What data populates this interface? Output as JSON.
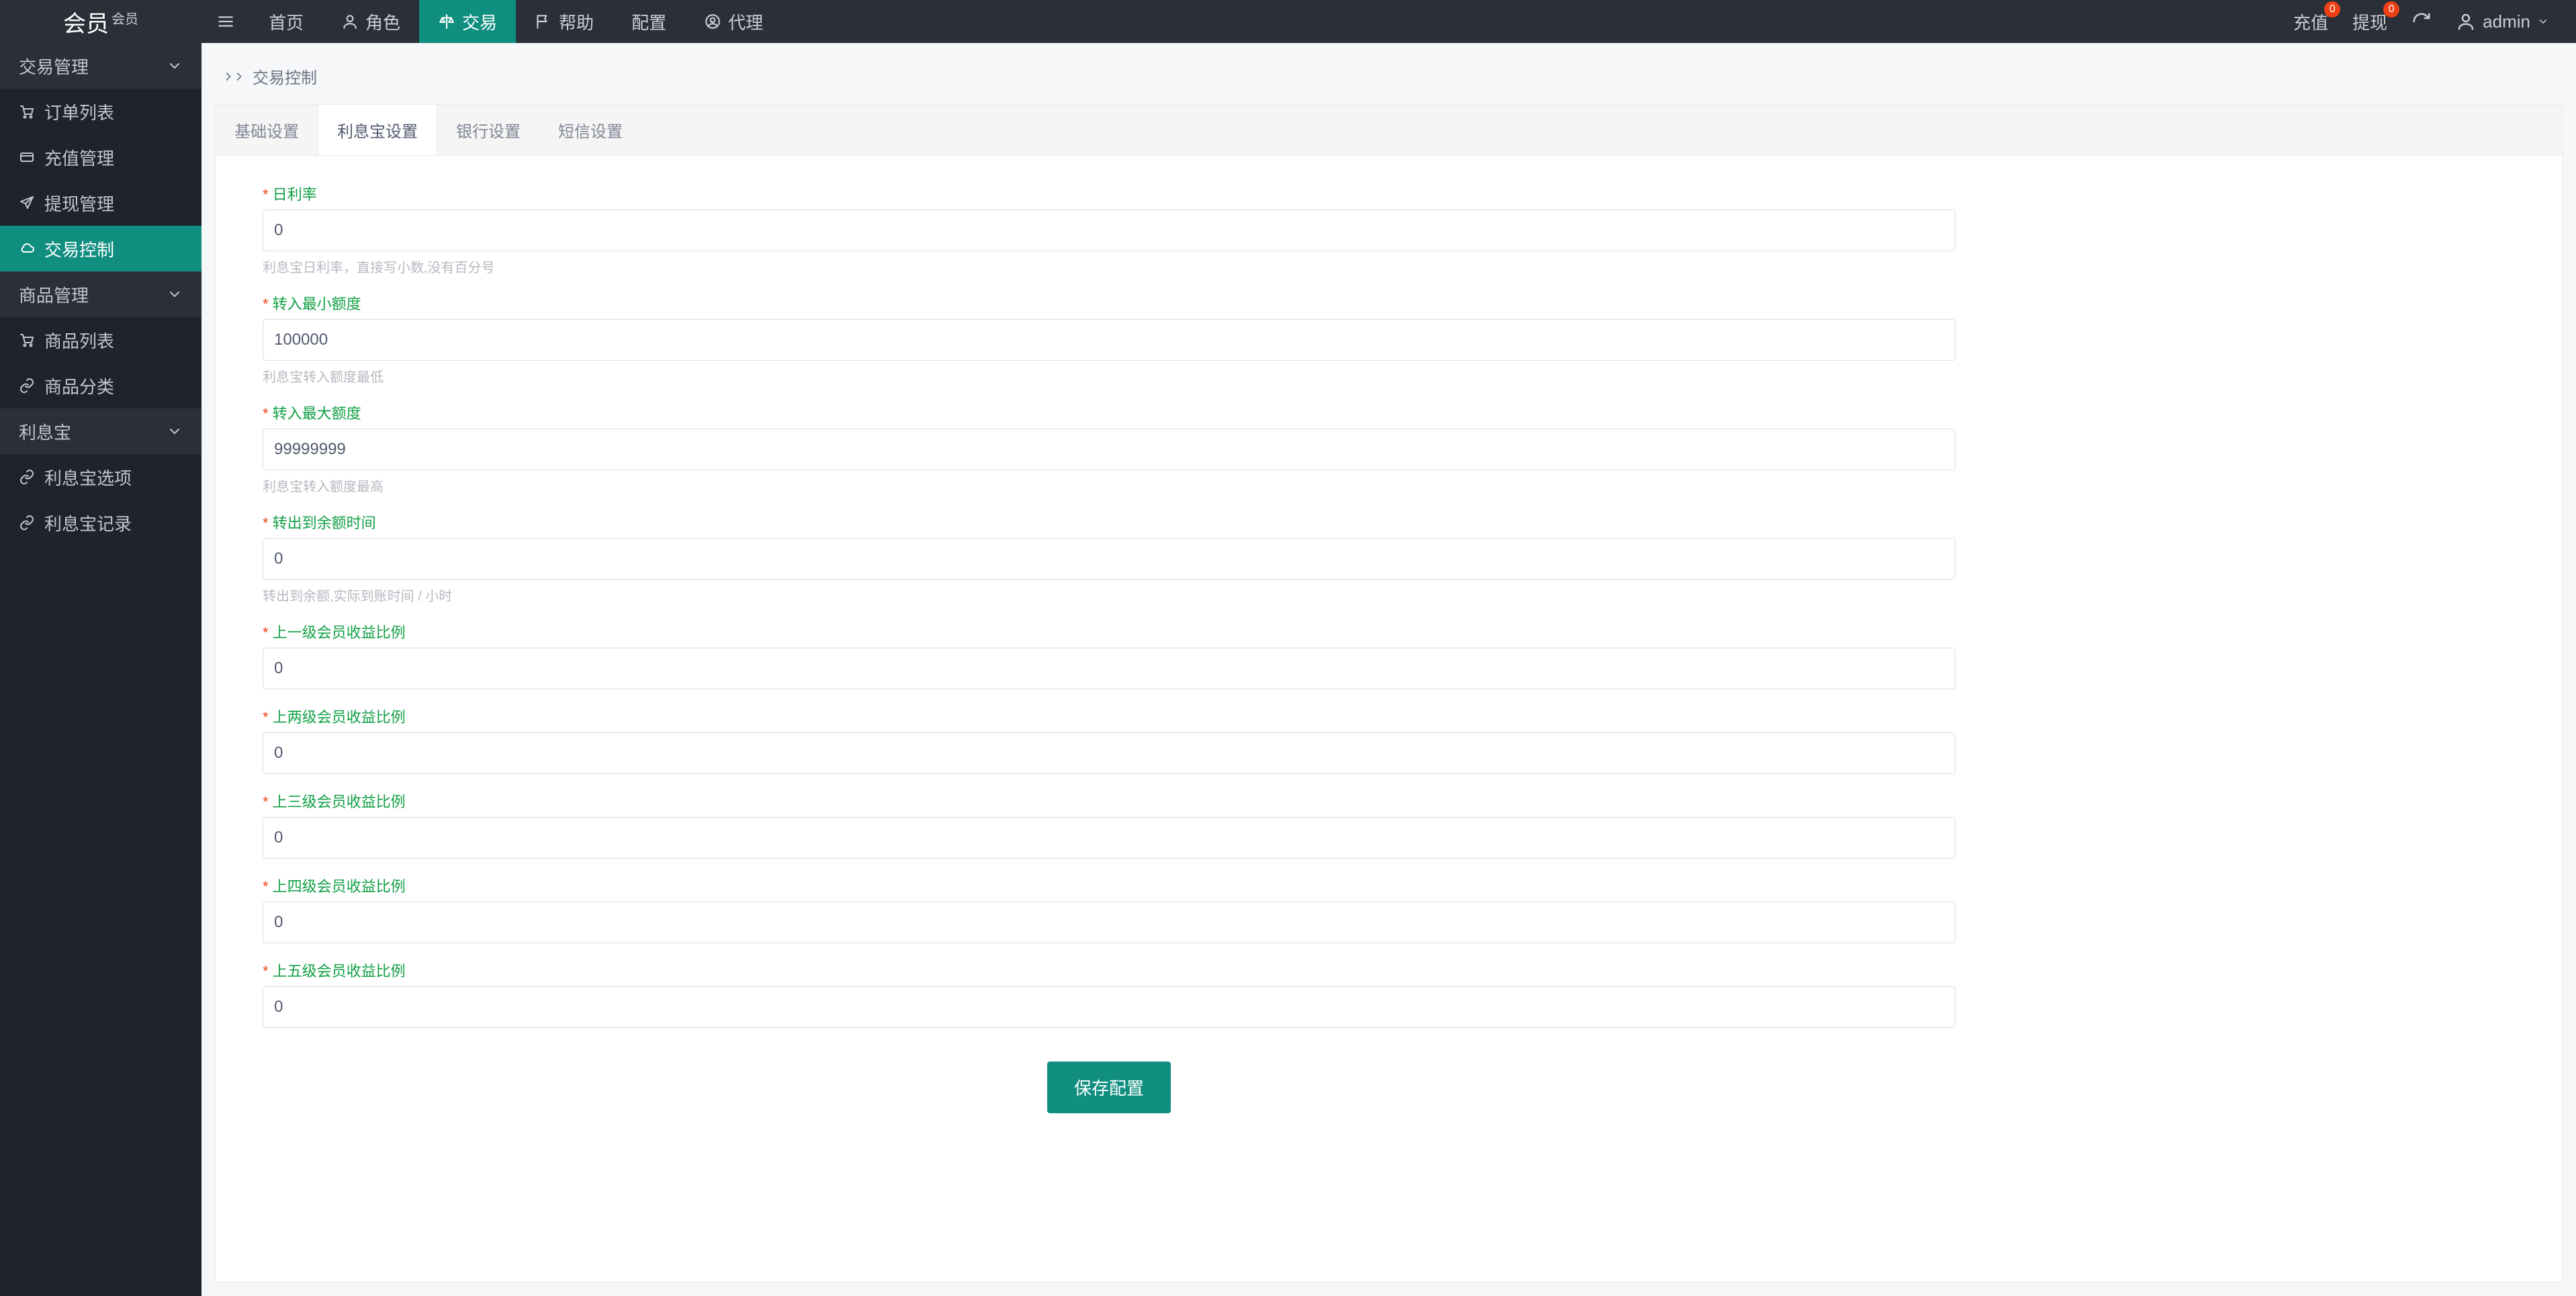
{
  "header": {
    "logo_main": "会员",
    "logo_sup": "会员",
    "nav": [
      {
        "label": "首页",
        "icon": null
      },
      {
        "label": "角色",
        "icon": "user"
      },
      {
        "label": "交易",
        "icon": "scale",
        "active": true
      },
      {
        "label": "帮助",
        "icon": "flag"
      },
      {
        "label": "配置",
        "icon": null
      },
      {
        "label": "代理",
        "icon": "user-circle"
      }
    ],
    "right": {
      "recharge": {
        "label": "充值",
        "badge": "0"
      },
      "withdraw": {
        "label": "提现",
        "badge": "0"
      },
      "user": "admin"
    }
  },
  "sidebar": {
    "groups": [
      {
        "title": "交易管理",
        "items": [
          {
            "label": "订单列表",
            "icon": "cart"
          },
          {
            "label": "充值管理",
            "icon": "card"
          },
          {
            "label": "提现管理",
            "icon": "plane"
          },
          {
            "label": "交易控制",
            "icon": "cloud",
            "active": true
          }
        ]
      },
      {
        "title": "商品管理",
        "items": [
          {
            "label": "商品列表",
            "icon": "cart"
          },
          {
            "label": "商品分类",
            "icon": "link"
          }
        ]
      },
      {
        "title": "利息宝",
        "items": [
          {
            "label": "利息宝选项",
            "icon": "link"
          },
          {
            "label": "利息宝记录",
            "icon": "link"
          }
        ]
      }
    ]
  },
  "breadcrumb": {
    "current": "交易控制"
  },
  "tabs": [
    {
      "label": "基础设置"
    },
    {
      "label": "利息宝设置",
      "active": true
    },
    {
      "label": "银行设置"
    },
    {
      "label": "短信设置"
    }
  ],
  "form": {
    "fields": [
      {
        "label": "日利率",
        "value": "0",
        "hint": "利息宝日利率，直接写小数,没有百分号"
      },
      {
        "label": "转入最小额度",
        "value": "100000",
        "hint": "利息宝转入额度最低"
      },
      {
        "label": "转入最大额度",
        "value": "99999999",
        "hint": "利息宝转入额度最高"
      },
      {
        "label": "转出到余额时间",
        "value": "0",
        "hint": "转出到余额,实际到账时间 / 小时"
      },
      {
        "label": "上一级会员收益比例",
        "value": "0"
      },
      {
        "label": "上两级会员收益比例",
        "value": "0"
      },
      {
        "label": "上三级会员收益比例",
        "value": "0"
      },
      {
        "label": "上四级会员收益比例",
        "value": "0"
      },
      {
        "label": "上五级会员收益比例",
        "value": "0"
      }
    ],
    "submit": "保存配置"
  }
}
